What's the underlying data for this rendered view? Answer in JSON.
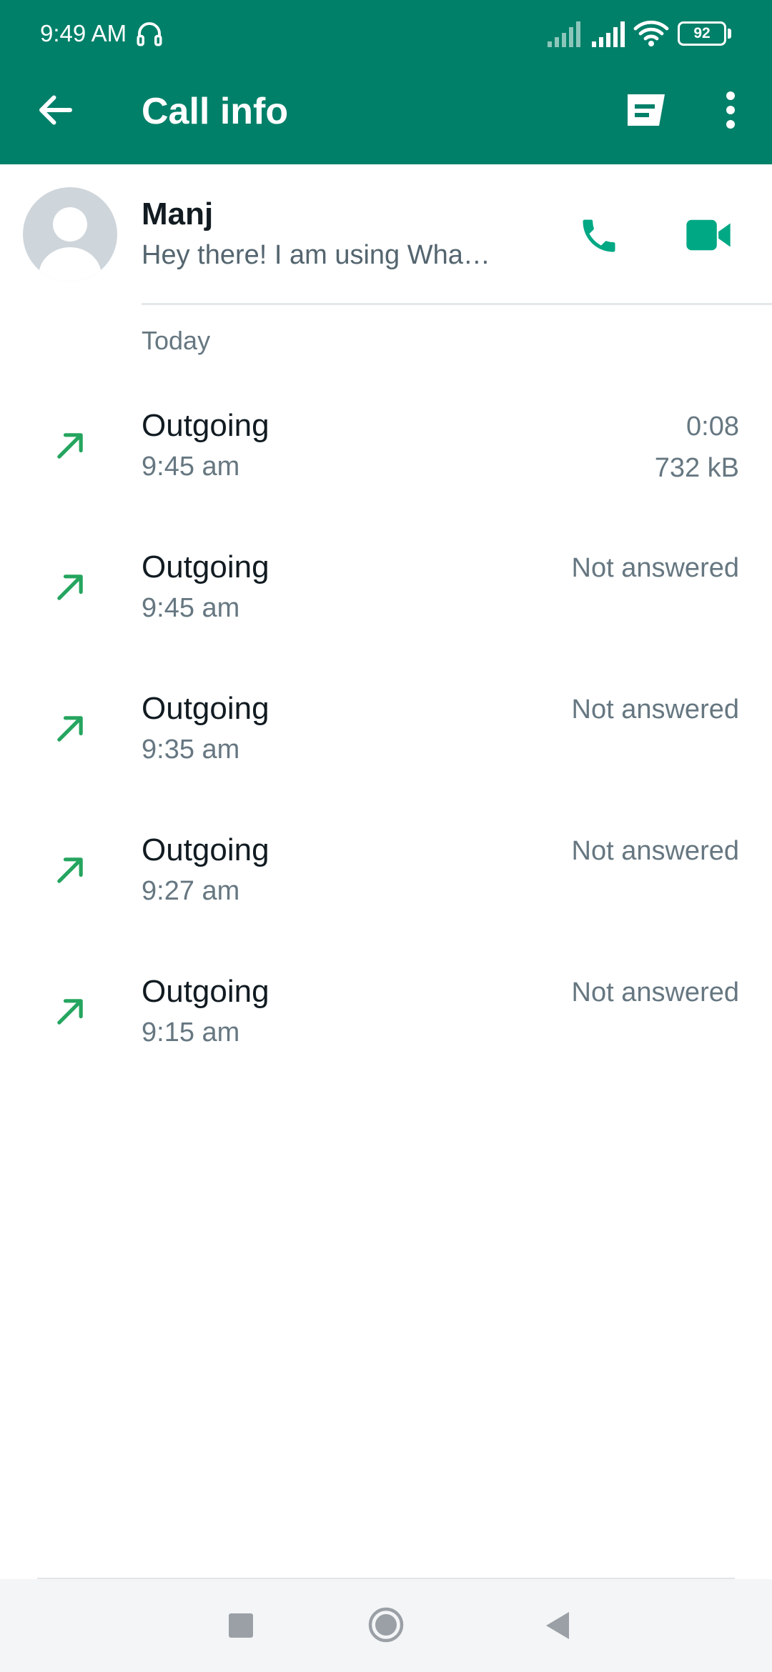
{
  "status_bar": {
    "time": "9:49 AM",
    "battery": "92"
  },
  "header": {
    "title": "Call info",
    "icons": [
      "back-arrow-icon",
      "new-message-icon",
      "more-options-icon"
    ]
  },
  "contact": {
    "name": "Manj",
    "status": "Hey there! I am using Wha…",
    "actions": [
      "voice-call-icon",
      "video-call-icon"
    ]
  },
  "calls": {
    "section_label": "Today",
    "items": [
      {
        "direction": "Outgoing",
        "time": "9:45 am",
        "status": "0:08",
        "size": "732 kB"
      },
      {
        "direction": "Outgoing",
        "time": "9:45 am",
        "status": "Not answered"
      },
      {
        "direction": "Outgoing",
        "time": "9:35 am",
        "status": "Not answered"
      },
      {
        "direction": "Outgoing",
        "time": "9:27 am",
        "status": "Not answered"
      },
      {
        "direction": "Outgoing",
        "time": "9:15 am",
        "status": "Not answered"
      }
    ]
  },
  "colors": {
    "header": "#008069",
    "accent": "#00a884",
    "outgoing_arrow": "#25a55f",
    "primary_text": "#111b21",
    "secondary_text": "#667781"
  },
  "nav_bar": {
    "icons": [
      "recents-icon",
      "home-icon",
      "back-icon"
    ]
  }
}
